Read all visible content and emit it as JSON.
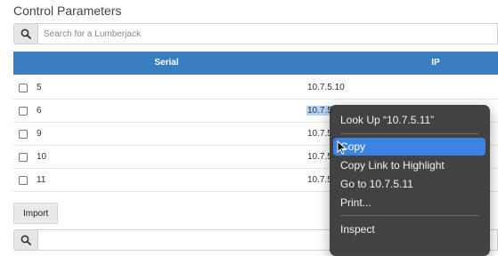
{
  "page": {
    "title": "Control Parameters"
  },
  "search": {
    "placeholder": "Search for a Lumberjack",
    "icon": "search-icon"
  },
  "table": {
    "headers": {
      "serial": "Serial",
      "ip": "IP"
    },
    "rows": [
      {
        "serial": "5",
        "ip": "10.7.5.10"
      },
      {
        "serial": "6",
        "ip": "10.7.5"
      },
      {
        "serial": "9",
        "ip": "10.7.5"
      },
      {
        "serial": "10",
        "ip": "10.7.5"
      },
      {
        "serial": "11",
        "ip": "10.7.5"
      }
    ]
  },
  "import_label": "Import",
  "context_menu": {
    "items": [
      {
        "label": "Look Up “10.7.5.11”"
      },
      {
        "label": "Copy"
      },
      {
        "label": "Copy Link to Highlight"
      },
      {
        "label": "Go to 10.7.5.11"
      },
      {
        "label": "Print..."
      },
      {
        "label": "Inspect"
      }
    ],
    "active_item": "Copy"
  },
  "colors": {
    "header_bg": "#3a7dc0",
    "menu_bg": "#343434",
    "menu_highlight": "#3b84e4",
    "selection": "#b4d4f8"
  }
}
